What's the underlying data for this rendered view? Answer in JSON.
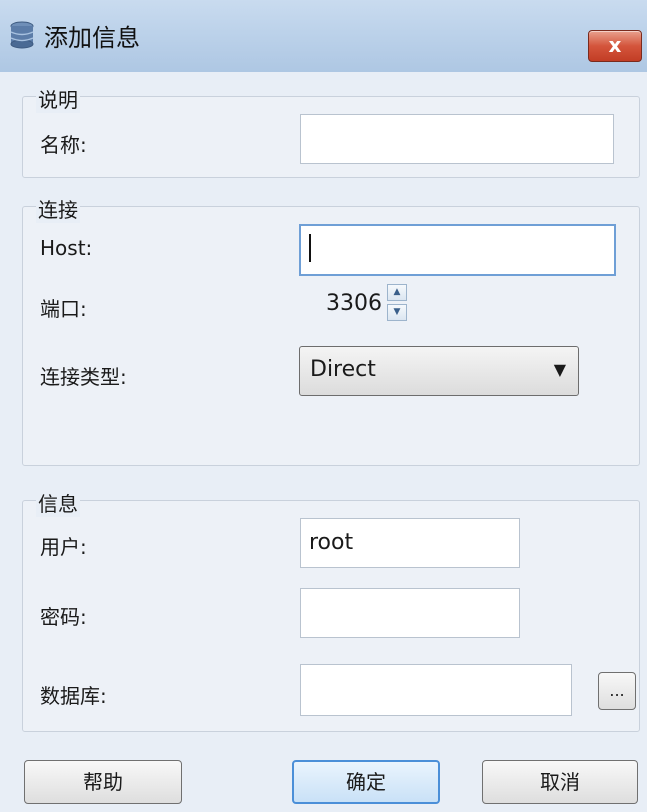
{
  "window": {
    "title": "添加信息",
    "close_label": "x"
  },
  "description": {
    "group_label": "说明",
    "name_label": "名称:",
    "name_value": ""
  },
  "connection": {
    "group_label": "连接",
    "host_label": "Host:",
    "host_value": "",
    "port_label": "端口:",
    "port_value": "3306",
    "type_label": "连接类型:",
    "type_value": "Direct"
  },
  "info": {
    "group_label": "信息",
    "user_label": "用户:",
    "user_value": "root",
    "password_label": "密码:",
    "password_value": "",
    "database_label": "数据库:",
    "database_value": "",
    "browse_label": "..."
  },
  "buttons": {
    "help": "帮助",
    "ok": "确定",
    "cancel": "取消"
  },
  "colors": {
    "titlebar": "#bcd2ea",
    "close": "#c94a31",
    "focus_border": "#6f9fd6",
    "default_button": "#4b8fd8"
  },
  "icons": {
    "app": "database-icon",
    "close": "close-icon",
    "spin_up": "triangle-up-icon",
    "spin_down": "triangle-down-icon",
    "dropdown": "chevron-down-icon"
  }
}
